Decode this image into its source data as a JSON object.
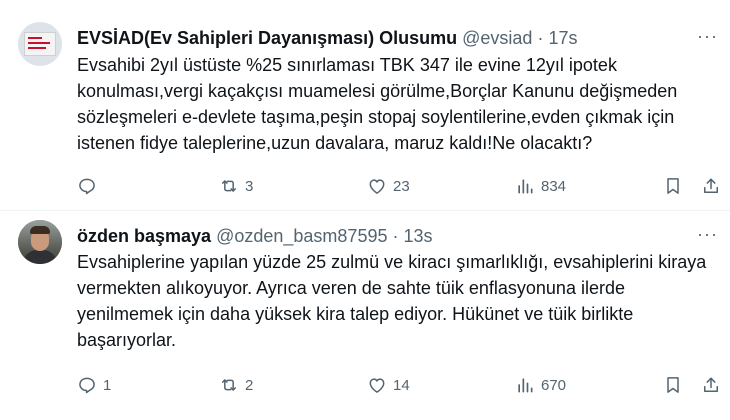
{
  "tweets": [
    {
      "display_name": "EVSİAD(Ev Sahipleri Dayanışması) Olusumu",
      "handle": "@evsiad",
      "separator": "·",
      "time": "17s",
      "text": "Evsahibi 2yıl üstüste %25 sınırlaması TBK 347 ile evine 12yıl ipotek konulması,vergi kaçakçısı muamelesi görülme,Borçlar Kanunu değişmeden sözleşmeleri e-devlete taşıma,peşin stopaj soylentilerine,evden çıkmak için istenen fidye taleplerine,uzun davalara, maruz kaldı!Ne olacaktı?",
      "more": "···",
      "replies": "",
      "retweets": "3",
      "likes": "23",
      "views": "834"
    },
    {
      "display_name": "özden başmaya",
      "handle": "@ozden_basm87595",
      "separator": "·",
      "time": "13s",
      "text": "Evsahiplerine yapılan yüzde 25 zulmü ve kiracı şımarlıklığı, evsahiplerini kiraya vermekten alıkoyuyor. Ayrıca veren de sahte tüik enflasyonuna ilerde yenilmemek için daha yüksek kira talep ediyor. Hükünet ve tüik birlikte başarıyorlar.",
      "more": "···",
      "replies": "1",
      "retweets": "2",
      "likes": "14",
      "views": "670"
    }
  ],
  "icons": [
    "reply-icon",
    "retweet-icon",
    "like-icon",
    "views-icon",
    "bookmark-icon",
    "share-icon",
    "more-icon"
  ],
  "colors": {
    "text": "#0f1419",
    "secondary": "#536471",
    "divider": "#eff3f4"
  }
}
